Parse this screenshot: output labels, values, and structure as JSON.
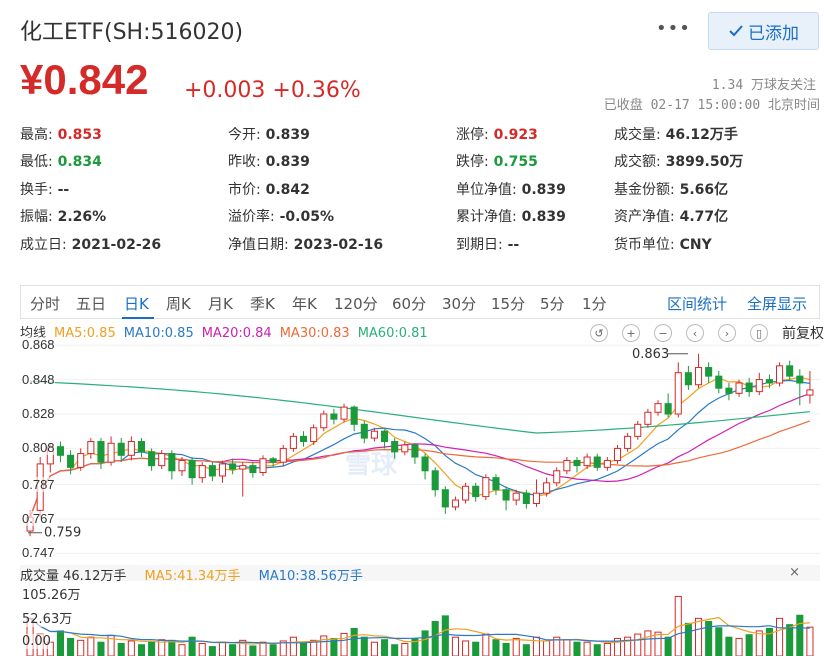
{
  "header": {
    "title": "化工ETF(SH:516020)",
    "more": "•••",
    "follow_label": "已添加"
  },
  "quote": {
    "price": "¥0.842",
    "change": "+0.003 +0.36%",
    "followers": "1.34 万球友关注",
    "status": "已收盘 02-17 15:00:00 北京时间"
  },
  "stats": [
    [
      {
        "k": "最高:",
        "v": "0.853",
        "c": "red"
      },
      {
        "k": "今开:",
        "v": "0.839",
        "c": ""
      },
      {
        "k": "涨停:",
        "v": "0.923",
        "c": "red"
      },
      {
        "k": "成交量:",
        "v": "46.12万手",
        "c": ""
      }
    ],
    [
      {
        "k": "最低:",
        "v": "0.834",
        "c": "green"
      },
      {
        "k": "昨收:",
        "v": "0.839",
        "c": ""
      },
      {
        "k": "跌停:",
        "v": "0.755",
        "c": "green"
      },
      {
        "k": "成交额:",
        "v": "3899.50万",
        "c": ""
      }
    ],
    [
      {
        "k": "换手:",
        "v": "--",
        "c": ""
      },
      {
        "k": "市价:",
        "v": "0.842",
        "c": ""
      },
      {
        "k": "单位净值:",
        "v": "0.839",
        "c": ""
      },
      {
        "k": "基金份额:",
        "v": "5.66亿",
        "c": ""
      }
    ],
    [
      {
        "k": "振幅:",
        "v": "2.26%",
        "c": ""
      },
      {
        "k": "溢价率:",
        "v": "-0.05%",
        "c": ""
      },
      {
        "k": "累计净值:",
        "v": "0.839",
        "c": ""
      },
      {
        "k": "资产净值:",
        "v": "4.77亿",
        "c": ""
      }
    ],
    [
      {
        "k": "成立日:",
        "v": "2021-02-26",
        "c": ""
      },
      {
        "k": "净值日期:",
        "v": "2023-02-16",
        "c": ""
      },
      {
        "k": "到期日:",
        "v": "--",
        "c": ""
      },
      {
        "k": "货币单位:",
        "v": "CNY",
        "c": ""
      }
    ]
  ],
  "tabs": [
    "分时",
    "五日",
    "日K",
    "周K",
    "月K",
    "季K",
    "年K",
    "120分",
    "60分",
    "30分",
    "15分",
    "5分",
    "1分"
  ],
  "active_tab": "日K",
  "tab_right": [
    "区间统计",
    "全屏显示"
  ],
  "ma": {
    "label": "均线",
    "items": [
      {
        "text": "MA5:0.85",
        "color": "#f0a020"
      },
      {
        "text": "MA10:0.85",
        "color": "#2a7ac8"
      },
      {
        "text": "MA20:0.84",
        "color": "#d020b0"
      },
      {
        "text": "MA30:0.83",
        "color": "#ee6a3a"
      },
      {
        "text": "MA60:0.81",
        "color": "#2ab07a"
      }
    ]
  },
  "tools": {
    "fq": "前复权"
  },
  "watermark": "雪球",
  "chart_data": {
    "type": "candlestick",
    "ylim": [
      0.742,
      0.871
    ],
    "y_ticks": [
      "0.868",
      "0.848",
      "0.828",
      "0.808",
      "0.787",
      "0.767",
      "0.747"
    ],
    "annotations": [
      {
        "text": "0.863"
      },
      {
        "text": "0.759"
      }
    ],
    "candles": [
      [
        0.76,
        0.768,
        0.757,
        0.772
      ],
      [
        0.772,
        0.799,
        0.768,
        0.803
      ],
      [
        0.799,
        0.809,
        0.794,
        0.811
      ],
      [
        0.809,
        0.804,
        0.8,
        0.812
      ],
      [
        0.804,
        0.797,
        0.793,
        0.807
      ],
      [
        0.797,
        0.805,
        0.795,
        0.808
      ],
      [
        0.805,
        0.812,
        0.802,
        0.814
      ],
      [
        0.812,
        0.8,
        0.796,
        0.814
      ],
      [
        0.8,
        0.811,
        0.798,
        0.815
      ],
      [
        0.811,
        0.804,
        0.8,
        0.814
      ],
      [
        0.804,
        0.812,
        0.801,
        0.815
      ],
      [
        0.812,
        0.806,
        0.803,
        0.814
      ],
      [
        0.806,
        0.798,
        0.795,
        0.808
      ],
      [
        0.798,
        0.805,
        0.796,
        0.807
      ],
      [
        0.805,
        0.795,
        0.79,
        0.807
      ],
      [
        0.795,
        0.801,
        0.792,
        0.803
      ],
      [
        0.801,
        0.791,
        0.787,
        0.803
      ],
      [
        0.791,
        0.798,
        0.788,
        0.8
      ],
      [
        0.798,
        0.792,
        0.789,
        0.8
      ],
      [
        0.792,
        0.799,
        0.788,
        0.801
      ],
      [
        0.799,
        0.796,
        0.793,
        0.802
      ],
      [
        0.796,
        0.798,
        0.78,
        0.8
      ],
      [
        0.798,
        0.794,
        0.791,
        0.8
      ],
      [
        0.794,
        0.802,
        0.792,
        0.804
      ],
      [
        0.802,
        0.8,
        0.797,
        0.803
      ],
      [
        0.8,
        0.808,
        0.798,
        0.81
      ],
      [
        0.808,
        0.815,
        0.806,
        0.817
      ],
      [
        0.815,
        0.812,
        0.809,
        0.818
      ],
      [
        0.812,
        0.82,
        0.81,
        0.822
      ],
      [
        0.82,
        0.828,
        0.818,
        0.83
      ],
      [
        0.828,
        0.825,
        0.822,
        0.831
      ],
      [
        0.825,
        0.832,
        0.823,
        0.834
      ],
      [
        0.832,
        0.822,
        0.818,
        0.833
      ],
      [
        0.822,
        0.814,
        0.811,
        0.824
      ],
      [
        0.814,
        0.818,
        0.812,
        0.82
      ],
      [
        0.818,
        0.812,
        0.808,
        0.819
      ],
      [
        0.812,
        0.806,
        0.802,
        0.814
      ],
      [
        0.806,
        0.81,
        0.804,
        0.812
      ],
      [
        0.81,
        0.803,
        0.799,
        0.811
      ],
      [
        0.803,
        0.795,
        0.79,
        0.805
      ],
      [
        0.795,
        0.784,
        0.78,
        0.797
      ],
      [
        0.784,
        0.774,
        0.77,
        0.786
      ],
      [
        0.774,
        0.778,
        0.772,
        0.78
      ],
      [
        0.778,
        0.786,
        0.776,
        0.788
      ],
      [
        0.786,
        0.78,
        0.777,
        0.788
      ],
      [
        0.78,
        0.791,
        0.778,
        0.793
      ],
      [
        0.791,
        0.784,
        0.781,
        0.793
      ],
      [
        0.784,
        0.778,
        0.772,
        0.786
      ],
      [
        0.778,
        0.782,
        0.775,
        0.784
      ],
      [
        0.782,
        0.776,
        0.773,
        0.784
      ],
      [
        0.776,
        0.782,
        0.774,
        0.79
      ],
      [
        0.782,
        0.788,
        0.78,
        0.791
      ],
      [
        0.788,
        0.795,
        0.786,
        0.797
      ],
      [
        0.795,
        0.801,
        0.793,
        0.803
      ],
      [
        0.801,
        0.798,
        0.794,
        0.803
      ],
      [
        0.798,
        0.803,
        0.796,
        0.805
      ],
      [
        0.803,
        0.797,
        0.795,
        0.805
      ],
      [
        0.797,
        0.801,
        0.795,
        0.803
      ],
      [
        0.801,
        0.808,
        0.799,
        0.81
      ],
      [
        0.808,
        0.815,
        0.806,
        0.817
      ],
      [
        0.815,
        0.822,
        0.813,
        0.824
      ],
      [
        0.822,
        0.829,
        0.82,
        0.831
      ],
      [
        0.829,
        0.834,
        0.827,
        0.836
      ],
      [
        0.834,
        0.828,
        0.826,
        0.84
      ],
      [
        0.828,
        0.852,
        0.826,
        0.858
      ],
      [
        0.852,
        0.845,
        0.842,
        0.856
      ],
      [
        0.845,
        0.855,
        0.843,
        0.863
      ],
      [
        0.855,
        0.85,
        0.846,
        0.858
      ],
      [
        0.85,
        0.843,
        0.84,
        0.853
      ],
      [
        0.843,
        0.84,
        0.836,
        0.846
      ],
      [
        0.84,
        0.846,
        0.838,
        0.848
      ],
      [
        0.846,
        0.841,
        0.838,
        0.849
      ],
      [
        0.841,
        0.848,
        0.839,
        0.852
      ],
      [
        0.848,
        0.846,
        0.843,
        0.851
      ],
      [
        0.846,
        0.856,
        0.844,
        0.858
      ],
      [
        0.856,
        0.85,
        0.847,
        0.859
      ],
      [
        0.85,
        0.846,
        0.833,
        0.854
      ],
      [
        0.839,
        0.842,
        0.834,
        0.853
      ]
    ]
  },
  "volume": {
    "label": "成交量 46.12万手",
    "ma5": "MA5:41.34万手",
    "ma10": "MA10:38.56万手",
    "ma5_color": "#f0a020",
    "ma10_color": "#2a7ac8",
    "close_icon": "×",
    "y_ticks": [
      "105.26万",
      "52.63万",
      "0.00"
    ],
    "max": 105.26,
    "values": [
      60,
      35,
      22,
      40,
      28,
      25,
      30,
      22,
      33,
      20,
      24,
      18,
      22,
      26,
      25,
      18,
      30,
      20,
      15,
      22,
      18,
      25,
      16,
      22,
      18,
      24,
      30,
      20,
      25,
      32,
      28,
      36,
      44,
      30,
      22,
      26,
      18,
      20,
      28,
      40,
      55,
      64,
      30,
      24,
      22,
      35,
      26,
      20,
      28,
      18,
      30,
      24,
      30,
      26,
      22,
      22,
      18,
      20,
      28,
      30,
      35,
      40,
      38,
      30,
      95,
      52,
      60,
      55,
      45,
      30,
      28,
      34,
      40,
      44,
      60,
      50,
      65,
      46
    ]
  }
}
